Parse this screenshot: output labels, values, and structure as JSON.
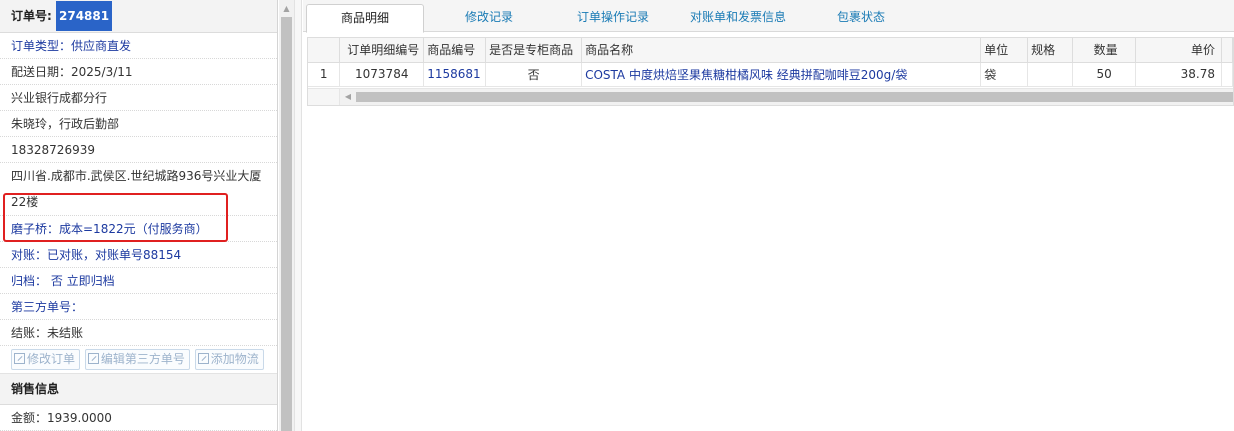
{
  "order": {
    "number_label": "订单号:",
    "number": "274881",
    "type": "订单类型：供应商直发",
    "delivery_date": "配送日期：2025/3/11",
    "bank": "兴业银行成都分行",
    "contact": "朱晓玲，行政后勤部",
    "phone": "18328726939",
    "address": "四川省.成都市.武侯区.世纪城路936号兴业大厦22楼",
    "cost": "磨子桥：成本=1822元（付服务商）",
    "reconcile": "对账：已对账，对账单号88154",
    "archive": "归档： 否 立即归档",
    "third_party": "第三方单号：",
    "settlement": "结账：未结账"
  },
  "actions": {
    "modify_order": "修改订单",
    "edit_third_party": "编辑第三方单号",
    "add_logistics": "添加物流"
  },
  "sales": {
    "section_title": "销售信息",
    "amount": "金额：1939.0000"
  },
  "tabs": [
    "商品明细",
    "修改记录",
    "订单操作记录",
    "对账单和发票信息",
    "包裹状态"
  ],
  "table": {
    "headers": [
      "订单明细编号",
      "商品编号",
      "是否是专柜商品",
      "商品名称",
      "单位",
      "规格",
      "数量",
      "单价"
    ],
    "rows": [
      {
        "index": "1",
        "detail_id": "1073784",
        "product_id": "1158681",
        "counter": "否",
        "name": "COSTA 中度烘焙坚果焦糖柑橘风味 经典拼配咖啡豆200g/袋",
        "unit": "袋",
        "spec": "",
        "qty": "50",
        "price": "38.78"
      }
    ]
  },
  "colors": {
    "accent_blue": "#2a64c8",
    "link": "#1d3aa0",
    "tab_text": "#1a7bb5",
    "highlight": "#e02020"
  }
}
